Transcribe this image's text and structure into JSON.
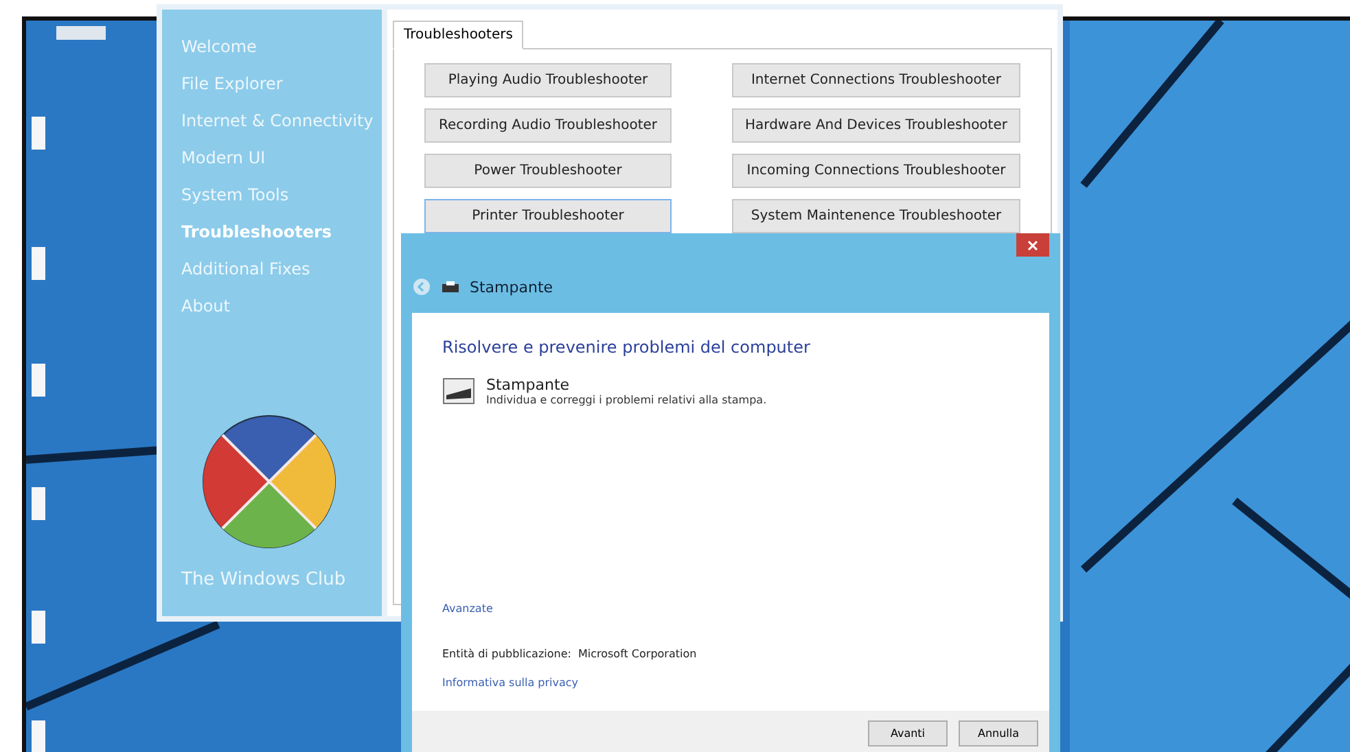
{
  "sidebar": {
    "items": [
      {
        "label": "Welcome",
        "selected": false
      },
      {
        "label": "File Explorer",
        "selected": false
      },
      {
        "label": "Internet & Connectivity",
        "selected": false
      },
      {
        "label": "Modern UI",
        "selected": false
      },
      {
        "label": "System Tools",
        "selected": false
      },
      {
        "label": "Troubleshooters",
        "selected": true
      },
      {
        "label": "Additional Fixes",
        "selected": false
      },
      {
        "label": "About",
        "selected": false
      }
    ],
    "brand": "The Windows Club"
  },
  "tabs": [
    {
      "label": "Troubleshooters",
      "selected": true
    }
  ],
  "buttons": [
    {
      "label": "Playing Audio Troubleshooter",
      "focused": false
    },
    {
      "label": "Internet Connections Troubleshooter",
      "focused": false
    },
    {
      "label": "Recording Audio Troubleshooter",
      "focused": false
    },
    {
      "label": "Hardware And Devices Troubleshooter",
      "focused": false
    },
    {
      "label": "Power Troubleshooter",
      "focused": false
    },
    {
      "label": "Incoming Connections Troubleshooter",
      "focused": false
    },
    {
      "label": "Printer Troubleshooter",
      "focused": true
    },
    {
      "label": "System Maintenence Troubleshooter",
      "focused": false
    }
  ],
  "dialog": {
    "title": "Stampante",
    "heading": "Risolvere e prevenire problemi del computer",
    "item": {
      "name": "Stampante",
      "description": "Individua e correggi i problemi relativi alla stampa."
    },
    "advanced_link": "Avanzate",
    "publisher_label": "Entità di pubblicazione:",
    "publisher": "Microsoft Corporation",
    "privacy_link": "Informativa sulla privacy",
    "buttons": [
      "Avanti",
      "Annulla"
    ]
  }
}
